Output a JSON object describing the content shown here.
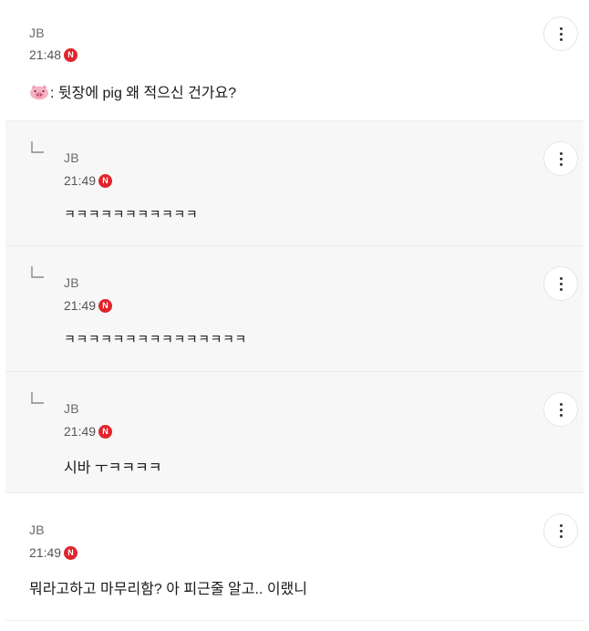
{
  "comments": [
    {
      "author": "JB",
      "time": "21:48",
      "badge": "N",
      "text": ": 뒷장에 pig 왜 적으신 건가요?",
      "emoji_icon": "pig-face-icon"
    },
    {
      "author": "JB",
      "time": "21:49",
      "badge": "N",
      "text": "ㅋㅋㅋㅋㅋㅋㅋㅋㅋㅋㅋ"
    },
    {
      "author": "JB",
      "time": "21:49",
      "badge": "N",
      "text": "ㅋㅋㅋㅋㅋㅋㅋㅋㅋㅋㅋㅋㅋㅋㅋ"
    },
    {
      "author": "JB",
      "time": "21:49",
      "badge": "N",
      "text": "시바 ㅜㅋㅋㅋㅋ"
    },
    {
      "author": "JB",
      "time": "21:49",
      "badge": "N",
      "text": "뭐라고하고 마무리함? 아 피근줄 알고.. 이랬니"
    }
  ],
  "colors": {
    "badge": "#e0242b",
    "reply_bg": "#f7f7f7"
  }
}
